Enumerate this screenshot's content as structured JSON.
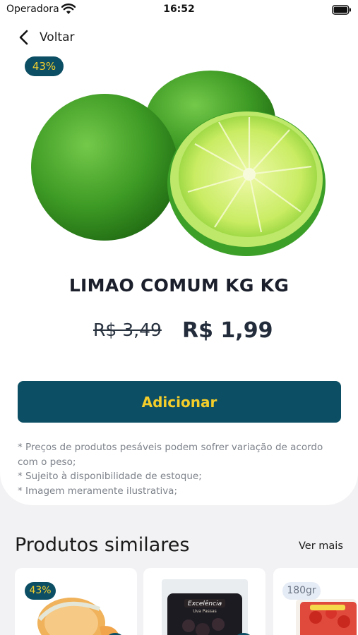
{
  "status_bar": {
    "carrier": "Operadora",
    "time": "16:52"
  },
  "nav": {
    "back_label": "Voltar"
  },
  "product": {
    "discount_badge": "43%",
    "name": "LIMAO COMUM KG KG",
    "old_price": "R$ 3,49",
    "new_price": "R$ 1,99",
    "add_button": "Adicionar",
    "disclaimer": [
      "* Preços de produtos pesáveis podem sofrer variação de acordo com o peso;",
      "* Sujeito à disponibilidade de estoque;",
      "* Imagem meramente ilustrativa;"
    ]
  },
  "similar": {
    "title": "Produtos similares",
    "see_more": "Ver mais",
    "items": [
      {
        "badge": "43%",
        "image": "melon"
      },
      {
        "label_top": "Excelência",
        "label_bottom": "Uva Passas",
        "image": "raisins-pack"
      },
      {
        "weight": "180gr",
        "image": "strawberry-pack"
      }
    ]
  },
  "colors": {
    "brand": "#0c4f64",
    "accent": "#f4cd2a",
    "background": "#f2f2f4"
  }
}
